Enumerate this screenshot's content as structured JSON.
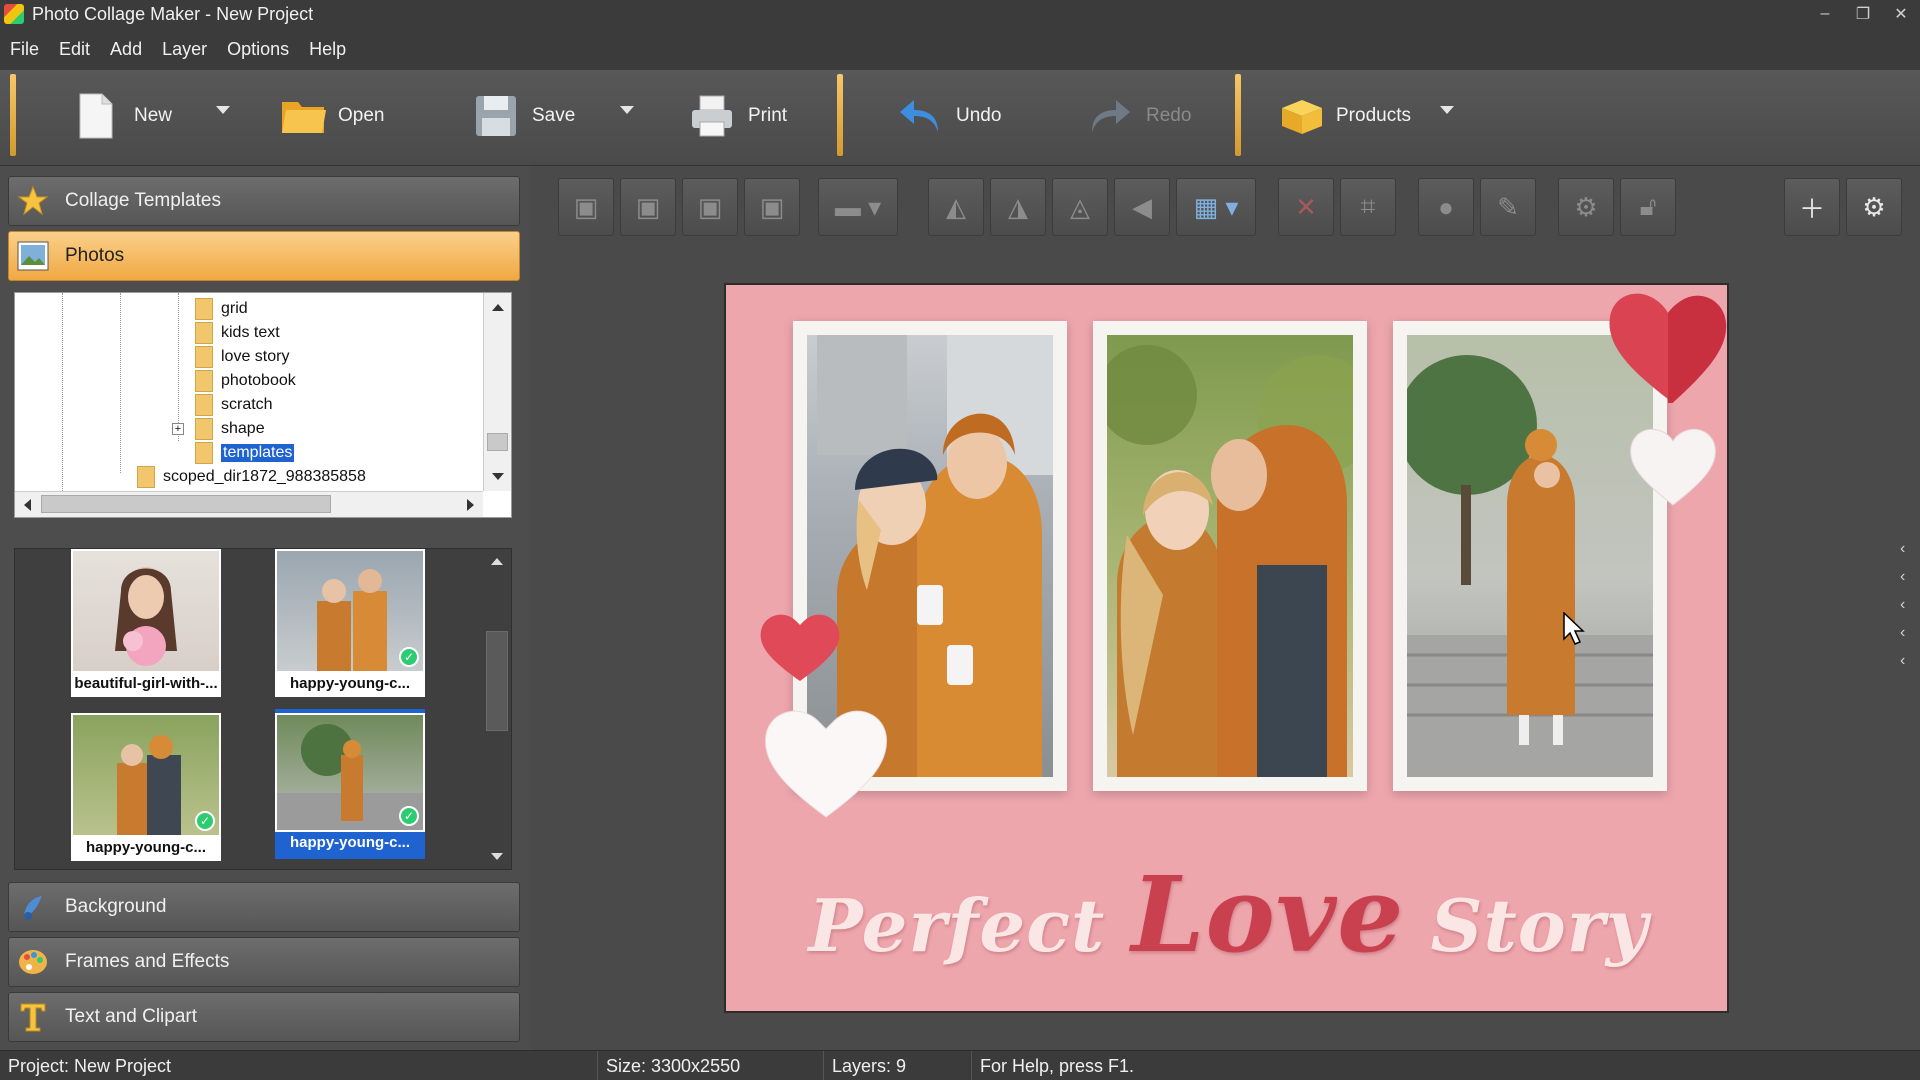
{
  "window": {
    "title": "Photo Collage Maker - New Project"
  },
  "menu": [
    "File",
    "Edit",
    "Add",
    "Layer",
    "Options",
    "Help"
  ],
  "toolbar": {
    "new_label": "New",
    "open_label": "Open",
    "save_label": "Save",
    "print_label": "Print",
    "undo_label": "Undo",
    "redo_label": "Redo",
    "products_label": "Products"
  },
  "left_panel": {
    "sections": {
      "collage_templates": "Collage Templates",
      "photos": "Photos",
      "background": "Background",
      "frames_effects": "Frames and Effects",
      "text_clipart": "Text and Clipart"
    },
    "folders": [
      "grid",
      "kids text",
      "love story",
      "photobook",
      "scratch",
      "shape",
      "templates",
      "scoped_dir1872_988385858"
    ],
    "selected_folder": "templates",
    "thumbnails": [
      {
        "label": "beautiful-girl-with-...",
        "used": false,
        "selected": false
      },
      {
        "label": "happy-young-c...",
        "used": true,
        "selected": false
      },
      {
        "label": "happy-young-c...",
        "used": true,
        "selected": false
      },
      {
        "label": "happy-young-c...",
        "used": true,
        "selected": true
      }
    ]
  },
  "collage": {
    "title_part1": "Perfect ",
    "title_love": "Love",
    "title_part2": " Story",
    "background_color": "#eea6ad",
    "accent_color": "#c9414f"
  },
  "statusbar": {
    "project": "Project: New Project",
    "size": "Size: 3300x2550",
    "layers": "Layers: 9",
    "help": "For Help, press F1."
  },
  "icons": [
    "new-icon",
    "open-folder-icon",
    "save-icon",
    "print-icon",
    "undo-icon",
    "redo-icon",
    "products-icon",
    "star-icon",
    "photos-icon",
    "background-icon",
    "palette-icon",
    "text-icon"
  ]
}
